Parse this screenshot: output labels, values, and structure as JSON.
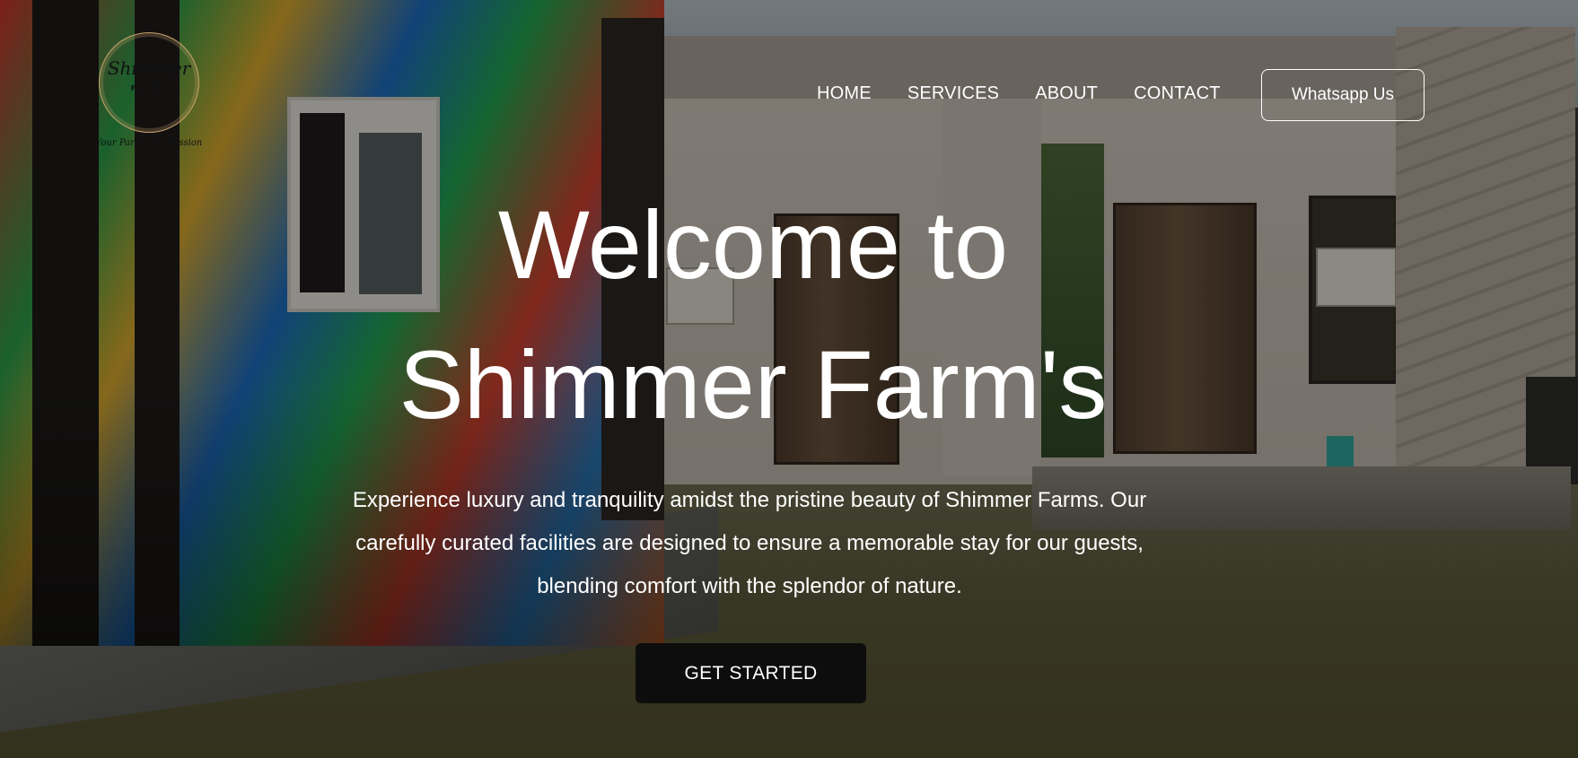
{
  "brand": {
    "logo_name": "Shimmer",
    "logo_sub": "FARMS",
    "logo_tagline": "Your Party, Our Passion"
  },
  "nav": {
    "items": [
      {
        "label": "HOME"
      },
      {
        "label": "SERVICES"
      },
      {
        "label": "ABOUT"
      },
      {
        "label": "CONTACT"
      }
    ],
    "whatsapp_label": "Whatsapp Us"
  },
  "hero": {
    "title_line1": "Welcome to",
    "title_line2": "Shimmer Farm's",
    "description": "Experience luxury and tranquility amidst the pristine beauty of Shimmer Farms. Our carefully curated facilities are designed to ensure a memorable stay for our guests, blending comfort with the splendor of nature.",
    "cta_label": "GET STARTED"
  },
  "colors": {
    "text": "#ffffff",
    "cta_bg": "#0d0d0d",
    "logo_gold": "#c9a46b"
  }
}
